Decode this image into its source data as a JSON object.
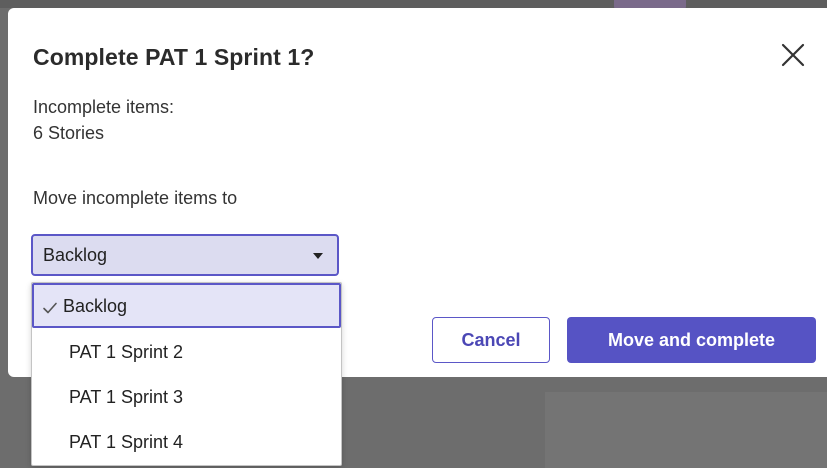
{
  "dialog": {
    "title": "Complete PAT 1 Sprint 1?",
    "incomplete_label": "Incomplete items:",
    "incomplete_count": "6 Stories",
    "move_label": "Move incomplete items to"
  },
  "select": {
    "value": "Backlog",
    "options": [
      "Backlog",
      "PAT 1 Sprint 2",
      "PAT 1 Sprint 3",
      "PAT 1 Sprint 4"
    ],
    "selected_index": 0
  },
  "buttons": {
    "cancel": "Cancel",
    "confirm": "Move and complete"
  },
  "colors": {
    "accent": "#5653c4",
    "overlay": "#6d6d6d",
    "selected_bg": "#e4e4f7"
  },
  "icons": {
    "close": "close-icon",
    "caret": "caret-down-icon",
    "check": "check-icon"
  }
}
